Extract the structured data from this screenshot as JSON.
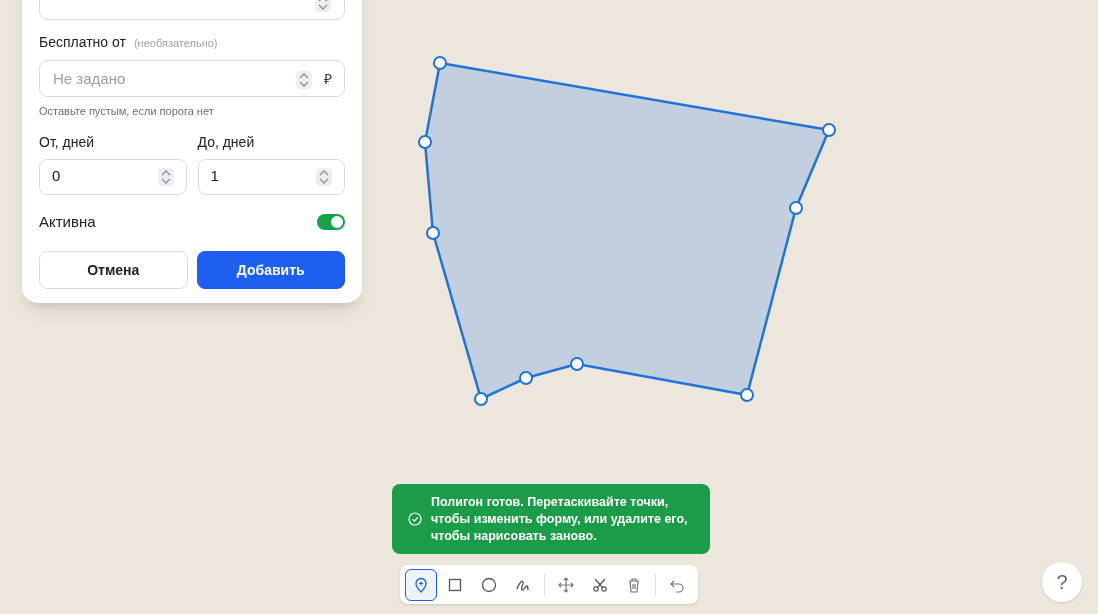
{
  "form": {
    "free_from": {
      "label": "Бесплатно от",
      "optional": "(необязательно)",
      "placeholder": "Не задано",
      "currency": "₽",
      "hint": "Оставьте пустым, если порога нет"
    },
    "days": [
      {
        "label": "От, дней",
        "value": "0"
      },
      {
        "label": "До, дней",
        "value": "1"
      }
    ],
    "active": {
      "label": "Активна",
      "on": true
    },
    "buttons": [
      {
        "kind": "secondary",
        "label": "Отмена"
      },
      {
        "kind": "primary",
        "label": "Добавить"
      }
    ]
  },
  "toast": {
    "text": "Полигон готов. Перетаскивайте точки, чтобы изменить форму, или удалите его, чтобы нарисовать заново."
  },
  "tool_groups": [
    [
      {
        "kind": "point",
        "selected": true
      },
      {
        "kind": "rectangle",
        "selected": false
      },
      {
        "kind": "circle",
        "selected": false
      },
      {
        "kind": "freehand",
        "selected": false
      }
    ],
    [
      {
        "kind": "move",
        "selected": false
      },
      {
        "kind": "cut",
        "selected": false
      },
      {
        "kind": "delete",
        "selected": false
      }
    ],
    [
      {
        "kind": "undo",
        "selected": false
      }
    ]
  ],
  "help_button": {
    "label": "?"
  }
}
